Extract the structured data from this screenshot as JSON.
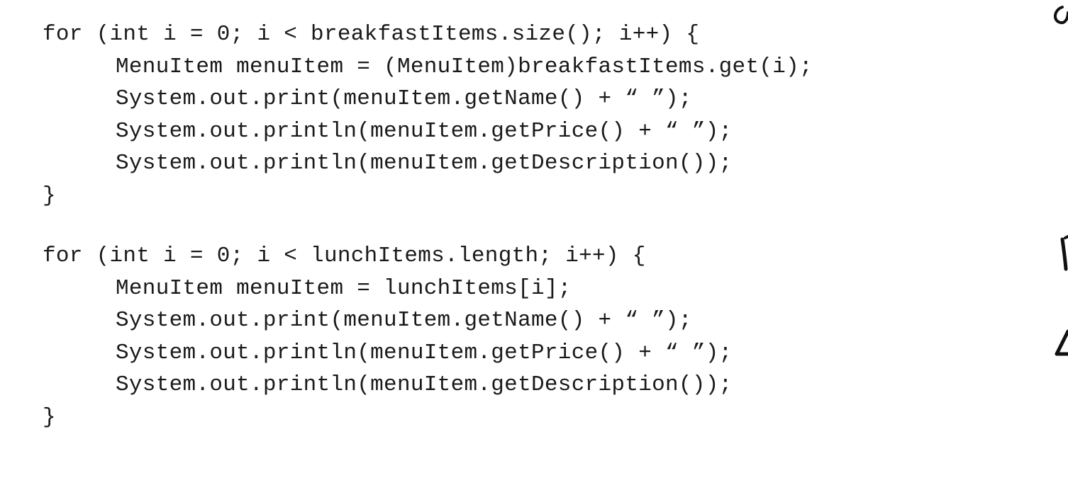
{
  "code_blocks": [
    {
      "lines": [
        "for (int i = 0; i < breakfastItems.size(); i++) {",
        "MenuItem menuItem = (MenuItem)breakfastItems.get(i);",
        "System.out.print(menuItem.getName() + “ ”);",
        "System.out.println(menuItem.getPrice() + “ ”);",
        "System.out.println(menuItem.getDescription());",
        "}"
      ]
    },
    {
      "lines": [
        "for (int i = 0; i < lunchItems.length; i++) {",
        "MenuItem menuItem = lunchItems[i];",
        "System.out.print(menuItem.getName() + “ ”);",
        "System.out.println(menuItem.getPrice() + “ ”);",
        "System.out.println(menuItem.getDescription());",
        "}"
      ]
    }
  ]
}
